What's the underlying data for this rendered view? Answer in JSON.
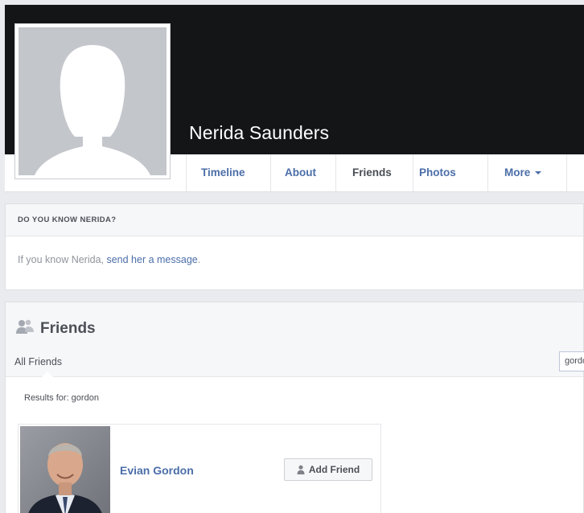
{
  "profile": {
    "name": "Nerida Saunders"
  },
  "tabs": [
    {
      "label": "Timeline"
    },
    {
      "label": "About"
    },
    {
      "label": "Friends"
    },
    {
      "label": "Photos"
    },
    {
      "label": "More"
    }
  ],
  "know_card": {
    "header": "DO YOU KNOW NERIDA?",
    "body_prefix": "If you know Nerida, ",
    "body_link": "send her a message",
    "body_suffix": "."
  },
  "friends": {
    "title": "Friends",
    "filter_tab": "All Friends",
    "search_value": "gordon",
    "results_label": "Results for: gordon",
    "results": [
      {
        "name": "Evian Gordon",
        "action_label": "Add Friend"
      }
    ]
  },
  "colors": {
    "link": "#4b6ea8",
    "cover": "#141517",
    "page_bg": "#e9ebee"
  },
  "icons": {
    "friends_section": "friends-icon",
    "add_friend": "add-person-icon",
    "more_caret": "chevron-down-icon"
  }
}
